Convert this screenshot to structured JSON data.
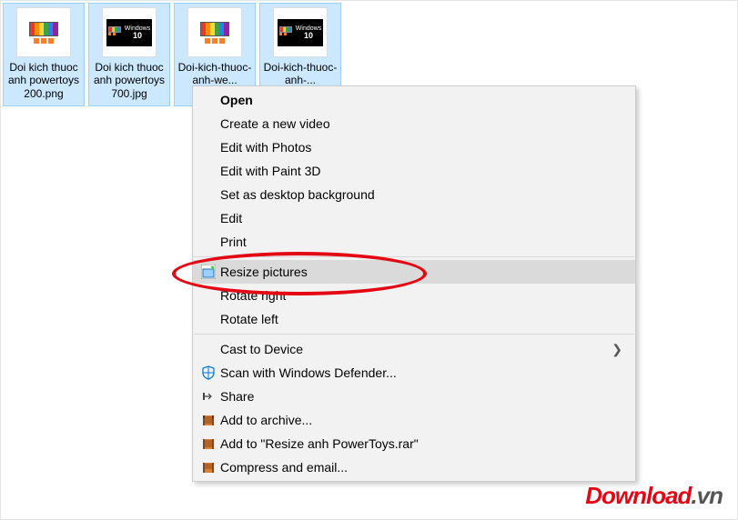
{
  "files": [
    {
      "name": "Doi kich thuoc anh powertoys 200.png",
      "thumb": "app"
    },
    {
      "name": "Doi kich thuoc anh powertoys 700.jpg",
      "thumb": "win10"
    },
    {
      "name": "Doi-kich-thuoc-anh-we...",
      "thumb": "app"
    },
    {
      "name": "Doi-kich-thuoc-anh-...",
      "thumb": "win10"
    }
  ],
  "menu": {
    "open": "Open",
    "create_video": "Create a new video",
    "edit_photos": "Edit with Photos",
    "edit_paint3d": "Edit with Paint 3D",
    "set_bg": "Set as desktop background",
    "edit": "Edit",
    "print": "Print",
    "resize_pictures": "Resize pictures",
    "rotate_right": "Rotate right",
    "rotate_left": "Rotate left",
    "cast": "Cast to Device",
    "defender": "Scan with Windows Defender...",
    "share": "Share",
    "add_archive": "Add to archive...",
    "add_to_rar": "Add to \"Resize anh PowerToys.rar\"",
    "compress_email": "Compress and email..."
  },
  "watermark": {
    "part1": "Download",
    "part2": ".vn"
  }
}
